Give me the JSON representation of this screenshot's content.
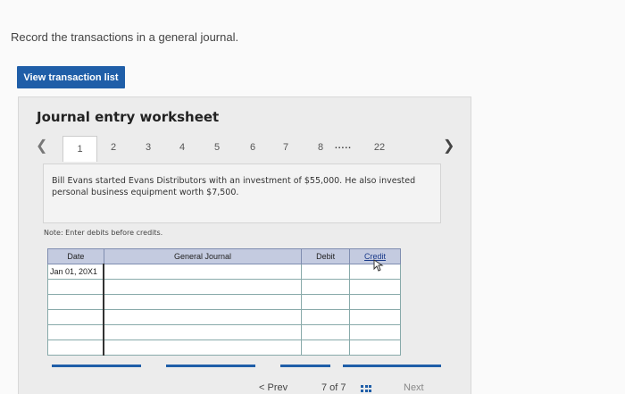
{
  "instruction": "Record the transactions in a general journal.",
  "view_button_label": "View transaction list",
  "worksheet_title": "Journal entry worksheet",
  "tabs": [
    "1",
    "2",
    "3",
    "4",
    "5",
    "6",
    "7",
    "8",
    "22"
  ],
  "tab_ellipsis": ".....",
  "active_tab": "1",
  "transaction_description": "Bill Evans started Evans Distributors with an investment of $55,000. He also invested personal business equipment worth $7,500.",
  "note": "Note: Enter debits before credits.",
  "journal": {
    "headers": [
      "Date",
      "General Journal",
      "Debit",
      "Credit"
    ],
    "rows": [
      {
        "date": "Jan 01, 20X1",
        "account": "",
        "debit": "",
        "credit": ""
      },
      {
        "date": "",
        "account": "",
        "debit": "",
        "credit": ""
      },
      {
        "date": "",
        "account": "",
        "debit": "",
        "credit": ""
      },
      {
        "date": "",
        "account": "",
        "debit": "",
        "credit": ""
      },
      {
        "date": "",
        "account": "",
        "debit": "",
        "credit": ""
      },
      {
        "date": "",
        "account": "",
        "debit": "",
        "credit": ""
      }
    ]
  },
  "bottom_nav": {
    "prev_label": "Prev",
    "page_label": "7 of 7",
    "next_label": "Next"
  },
  "icons": {
    "prev_tab": "chevron-left-icon",
    "next_tab": "chevron-right-icon",
    "grid": "grid-icon"
  },
  "colors": {
    "accent": "#1f5ea8",
    "header_bg": "#c4cbe0"
  }
}
